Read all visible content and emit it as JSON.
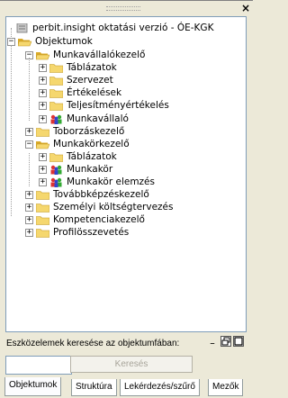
{
  "title_close": "×",
  "tree": {
    "root": "perbit.insight oktatási verzió - ÓE-KGK",
    "objects": "Objektumok",
    "items": [
      {
        "label": "Munkavállalókezelő",
        "level": 2,
        "expander": "−"
      },
      {
        "label": "Táblázatok",
        "level": 3,
        "expander": "+"
      },
      {
        "label": "Szervezet",
        "level": 3,
        "expander": "+"
      },
      {
        "label": "Értékelések",
        "level": 3,
        "expander": "+"
      },
      {
        "label": "Teljesítményértékelés",
        "level": 3,
        "expander": "+"
      },
      {
        "label": "Munkavállaló",
        "level": 3,
        "expander": "+"
      },
      {
        "label": "Toborzáskezelő",
        "level": 2,
        "expander": "+"
      },
      {
        "label": "Munkakörkezelő",
        "level": 2,
        "expander": "−"
      },
      {
        "label": "Táblázatok",
        "level": 3,
        "expander": "+"
      },
      {
        "label": "Munkakör",
        "level": 3,
        "expander": "+"
      },
      {
        "label": "Munkakör elemzés",
        "level": 3,
        "expander": "+"
      },
      {
        "label": "Továbbképzéskezelő",
        "level": 2,
        "expander": "+"
      },
      {
        "label": "Személyi költségtervezés",
        "level": 2,
        "expander": "+"
      },
      {
        "label": "Kompetenciakezelő",
        "level": 2,
        "expander": "+"
      },
      {
        "label": "Profilösszevetés",
        "level": 2,
        "expander": "+"
      }
    ],
    "objects_expander": "−"
  },
  "search": {
    "label": "Eszközelemek keresése az objektumfában:",
    "value": "",
    "button": "Keresés",
    "win_minimize": "_",
    "win_restore": "□"
  },
  "tabs": [
    {
      "label": "Objektumok",
      "active": true
    },
    {
      "label": "Struktúra",
      "active": false
    },
    {
      "label": "Lekérdezés/szűrő",
      "active": false
    },
    {
      "label": "Mezők",
      "active": false
    }
  ],
  "colors": {
    "folder": "#f5d76e",
    "folder_dark": "#d9a928",
    "user_icon_red": "#d33",
    "user_icon_green": "#3a3",
    "user_icon_blue": "#34c"
  }
}
